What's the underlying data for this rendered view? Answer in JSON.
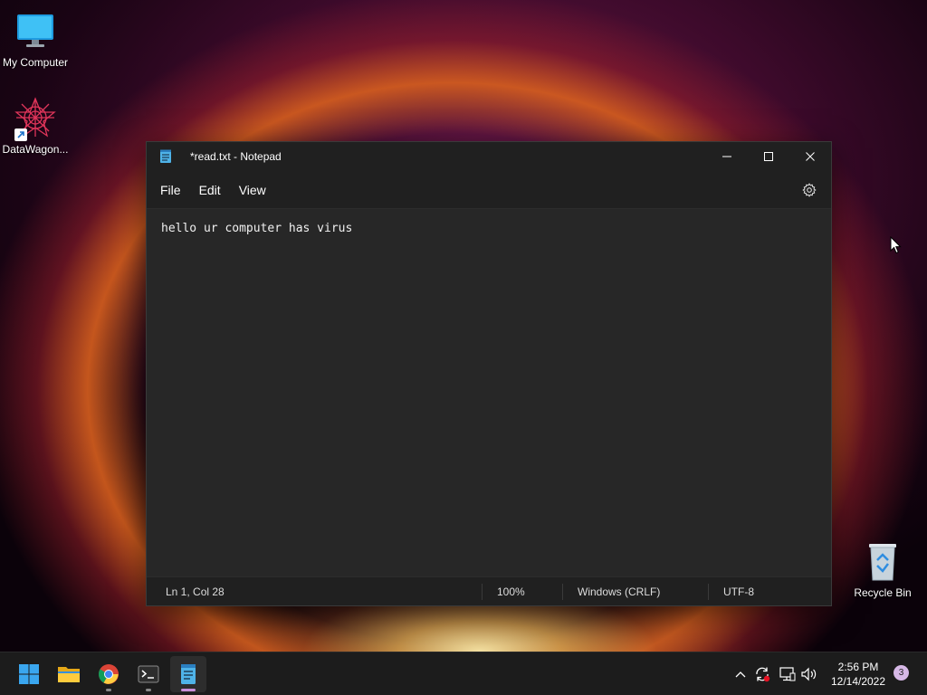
{
  "desktop": {
    "icons": [
      {
        "label": "My Computer",
        "icon": "monitor-icon"
      },
      {
        "label": "DataWagon...",
        "icon": "datawagon-logo-icon"
      },
      {
        "label": "Recycle Bin",
        "icon": "recycle-bin-icon"
      }
    ]
  },
  "window": {
    "title": "*read.txt - Notepad",
    "app_icon": "notepad-icon",
    "controls": [
      "minimize-icon",
      "maximize-icon",
      "close-icon"
    ]
  },
  "menu": {
    "items": [
      "File",
      "Edit",
      "View"
    ],
    "settings_icon": "gear-icon"
  },
  "editor": {
    "content": "hello ur computer has virus"
  },
  "status": {
    "position": "Ln 1, Col 28",
    "zoom": "100%",
    "line_ending": "Windows (CRLF)",
    "encoding": "UTF-8"
  },
  "taskbar": {
    "apps": [
      "windows-start-icon",
      "file-explorer-icon",
      "chrome-icon",
      "terminal-icon",
      "notepad-icon"
    ],
    "tray": [
      "chevron-up-icon",
      "sync-icon",
      "network-icon",
      "volume-icon"
    ],
    "time": "2:56 PM",
    "date": "12/14/2022",
    "notification_count": "3"
  },
  "colors": {
    "accent": "#c98fd9",
    "window_bg": "#272727",
    "titlebar_bg": "#202020",
    "taskbar_bg": "#1c1c1c"
  }
}
